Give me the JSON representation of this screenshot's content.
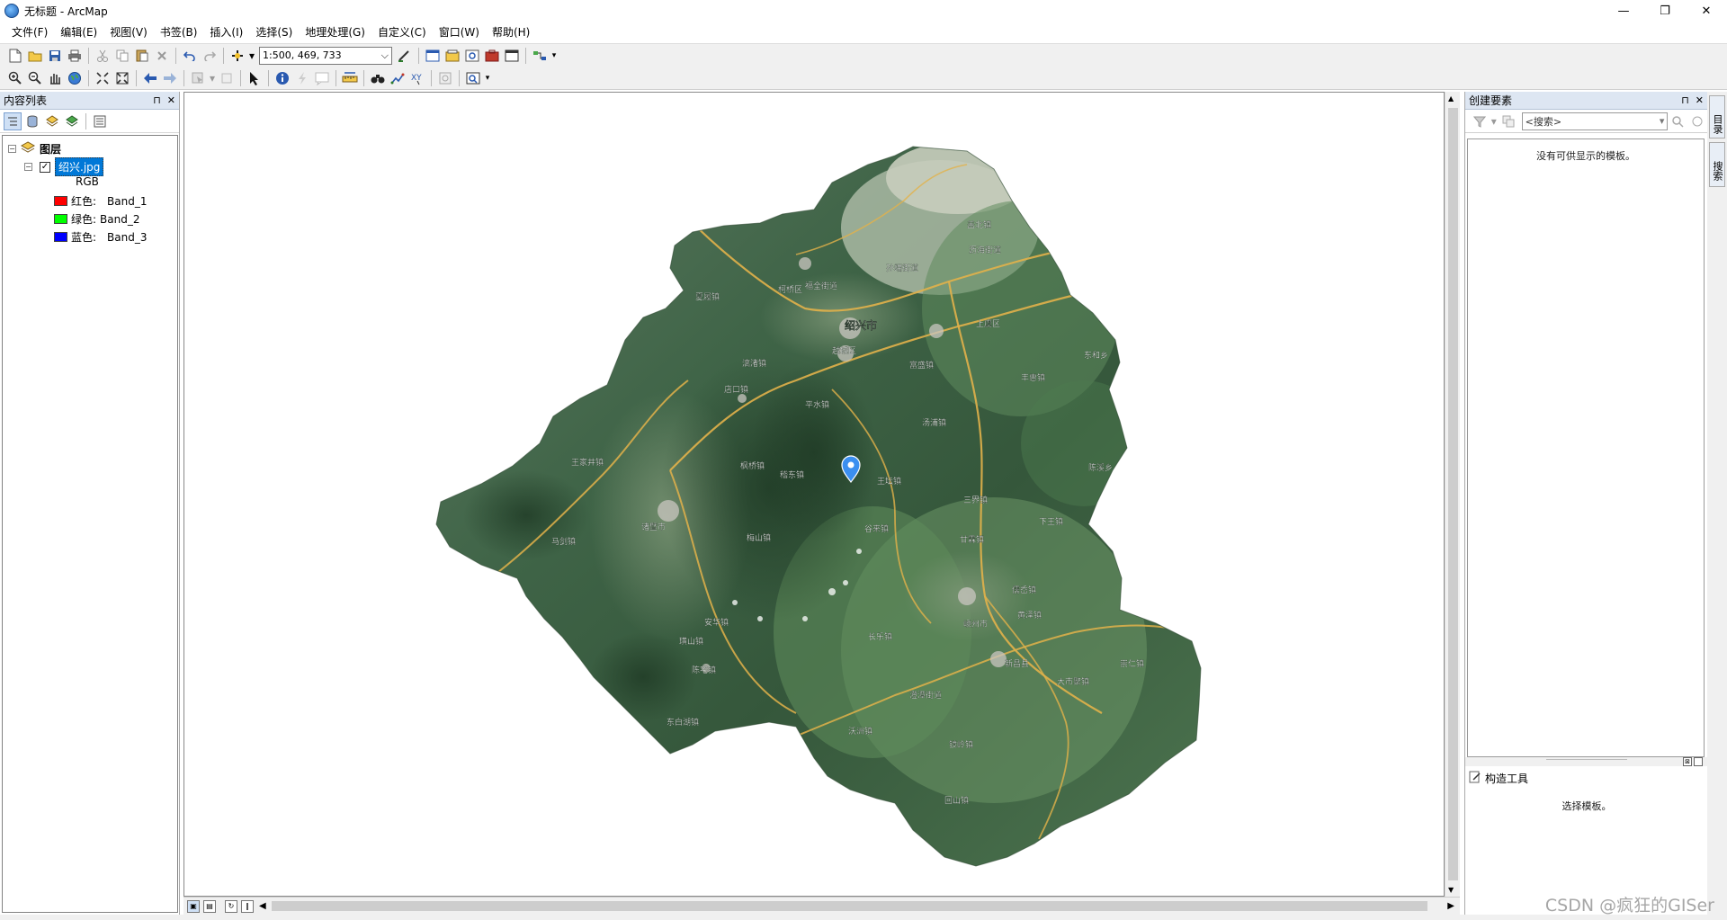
{
  "window": {
    "title": "无标题 - ArcMap",
    "minimize": "—",
    "maximize": "❐",
    "close": "✕"
  },
  "menu": [
    "文件(F)",
    "编辑(E)",
    "视图(V)",
    "书签(B)",
    "插入(I)",
    "选择(S)",
    "地理处理(G)",
    "自定义(C)",
    "窗口(W)",
    "帮助(H)"
  ],
  "scale": {
    "value": "1:500, 469, 733"
  },
  "toc": {
    "title": "内容列表",
    "root_label": "图层",
    "layer_label": "绍兴.jpg",
    "rgb_label": "RGB",
    "bands": [
      {
        "label": "红色:",
        "band": "Band_1",
        "color": "#ff0000"
      },
      {
        "label": "绿色:",
        "band": "Band_2",
        "color": "#00ff00"
      },
      {
        "label": "蓝色:",
        "band": "Band_3",
        "color": "#0000ff"
      }
    ]
  },
  "create_features": {
    "title": "创建要素",
    "search_placeholder": "<搜索>",
    "empty_message": "没有可供显示的模板。",
    "construct_title": "构造工具",
    "construct_message": "选择模板。"
  },
  "right_tabs": [
    "目录",
    "搜索"
  ],
  "map": {
    "labels": [
      "绍兴市",
      "柯桥区",
      "越城区",
      "上虞区",
      "诸暨市",
      "嵊州市",
      "新昌县",
      "枫桥镇",
      "平水镇",
      "王坛镇",
      "谷来镇",
      "三界镇",
      "甘霖镇",
      "长乐镇",
      "东和乡",
      "丰惠镇",
      "下王镇",
      "陈溪乡",
      "儒岙镇",
      "回山镇",
      "镜岭镇",
      "沃洲镇",
      "大市聚镇",
      "澄潭街道",
      "崇仁镇",
      "店口镇",
      "安华镇",
      "王家井镇",
      "璜山镇",
      "陈宅镇",
      "东白湖镇",
      "富盛镇",
      "汤浦镇",
      "稽东镇",
      "孙端街道",
      "沥海街道",
      "盖北镇",
      "夏履镇",
      "漓渚镇",
      "福全街道",
      "马剑镇",
      "梅山镇",
      "黄泽镇"
    ]
  },
  "watermark": "CSDN @疯狂的GISer"
}
